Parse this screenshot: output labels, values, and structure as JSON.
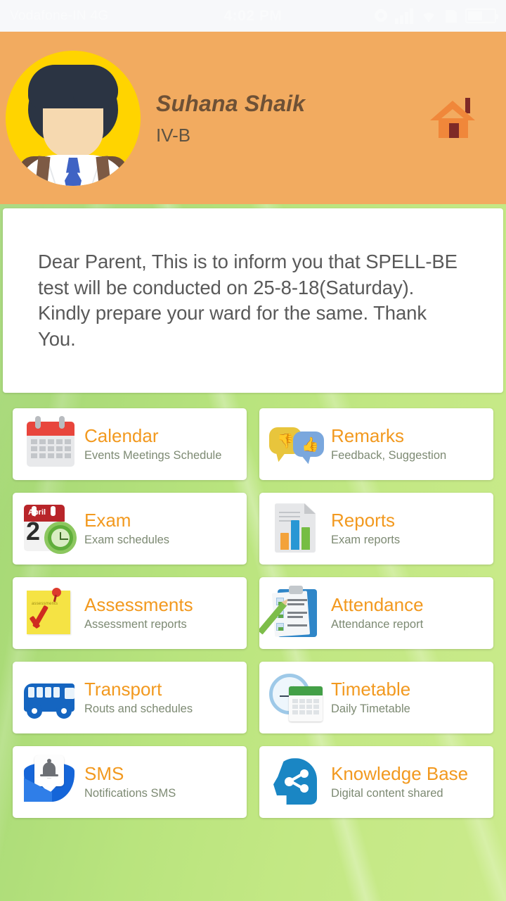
{
  "statusbar": {
    "carrier": "Vodafone-IN 4G",
    "time": "4:02 PM",
    "icons": [
      "location-icon",
      "signal-icon",
      "wifi-icon",
      "battery-icon"
    ]
  },
  "header": {
    "student_name": "Suhana Shaik",
    "student_class": "IV-B",
    "avatar_name": "student-avatar",
    "home_icon": "home-icon",
    "bg_color": "#f2ab60",
    "avatar_bg_color": "#ffd400"
  },
  "notice": {
    "message": "Dear Parent, This is to inform you that SPELL-BE test will be conducted on 25-8-18(Saturday). Kindly prepare your ward for the same. Thank You."
  },
  "theme": {
    "title_color": "#f2991f",
    "subtitle_color": "#7d8a73",
    "background_green": "#b6e07a"
  },
  "grid": {
    "tiles": [
      {
        "title": "Calendar",
        "subtitle": "Events Meetings Schedule",
        "icon": "calendar-icon"
      },
      {
        "title": "Remarks",
        "subtitle": "Feedback, Suggestion",
        "icon": "speech-bubbles-icon"
      },
      {
        "title": "Exam",
        "subtitle": "Exam schedules",
        "icon": "exam-calendar-clock-icon"
      },
      {
        "title": "Reports",
        "subtitle": "Exam reports",
        "icon": "document-barchart-icon"
      },
      {
        "title": "Assessments",
        "subtitle": "Assessment reports",
        "icon": "sticky-note-check-icon"
      },
      {
        "title": "Attendance",
        "subtitle": "Attendance report",
        "icon": "clipboard-pencil-icon"
      },
      {
        "title": "Transport",
        "subtitle": "Routs and schedules",
        "icon": "bus-icon"
      },
      {
        "title": "Timetable",
        "subtitle": "Daily Timetable",
        "icon": "clock-calendar-icon"
      },
      {
        "title": "SMS",
        "subtitle": "Notifications SMS",
        "icon": "envelope-bell-icon"
      },
      {
        "title": "Knowledge Base",
        "subtitle": "Digital content shared",
        "icon": "head-share-icon"
      }
    ],
    "exam_icon_month": "April",
    "exam_icon_day": "2",
    "assessment_icon_label": "assessments"
  }
}
